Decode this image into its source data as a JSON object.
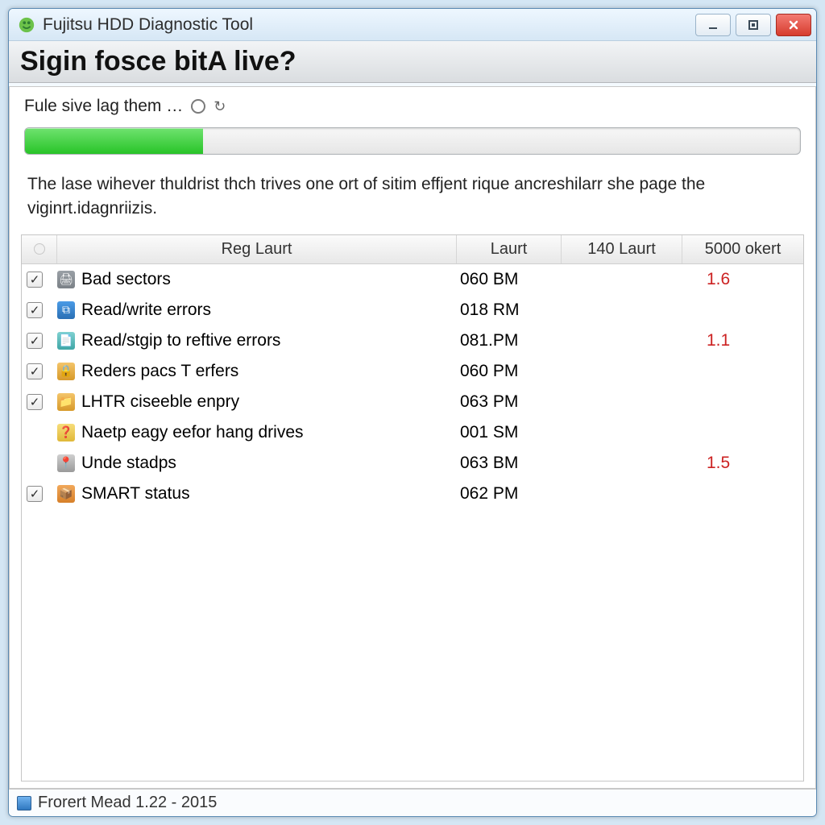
{
  "window": {
    "title": "Fujitsu HDD Diagnostic Tool"
  },
  "header": {
    "heading": "Sigin fosce bitA live?",
    "subhead": "Fule sive lag them …"
  },
  "progress": {
    "percent": 23
  },
  "description": "The lase wihever thuldrist thch trives one ort of sitim effjent rique ancreshilarr she page the viginrt.idagnriizis.",
  "table": {
    "headers": {
      "check": "",
      "name": "Reg Laurt",
      "colA": "Laurt",
      "colB": "140 Laurt",
      "colC": "5000 okert"
    },
    "rows": [
      {
        "checked": true,
        "icon": "ic-gray",
        "iconGlyph": "🖨",
        "name": "Bad sectors",
        "a": "060 BM",
        "b": "",
        "c": "1.6"
      },
      {
        "checked": true,
        "icon": "ic-blue",
        "iconGlyph": "⧉",
        "name": "Read/write errors",
        "a": "018 RM",
        "b": "",
        "c": ""
      },
      {
        "checked": true,
        "icon": "ic-teal",
        "iconGlyph": "📄",
        "name": "Read/stgip to reftive errors",
        "a": "081.PM",
        "b": "",
        "c": "1.1"
      },
      {
        "checked": true,
        "icon": "ic-amber",
        "iconGlyph": "🔒",
        "name": "Reders pacs T erfers",
        "a": "060 PM",
        "b": "",
        "c": ""
      },
      {
        "checked": true,
        "icon": "ic-amber2",
        "iconGlyph": "📁",
        "name": "LHTR ciseeble enpry",
        "a": "063 PM",
        "b": "",
        "c": ""
      },
      {
        "checked": false,
        "icon": "ic-yellow",
        "iconGlyph": "❓",
        "name": "Naetp eagy eefor hang drives",
        "a": "001 SM",
        "b": "",
        "c": ""
      },
      {
        "checked": false,
        "icon": "ic-pin",
        "iconGlyph": "📍",
        "name": "Unde stadps",
        "a": "063 BM",
        "b": "",
        "c": "1.5"
      },
      {
        "checked": true,
        "icon": "ic-orange",
        "iconGlyph": "📦",
        "name": "SMART status",
        "a": "062 PM",
        "b": "",
        "c": ""
      }
    ]
  },
  "status": {
    "text": "Frorert Mead 1.22 - 2015"
  }
}
